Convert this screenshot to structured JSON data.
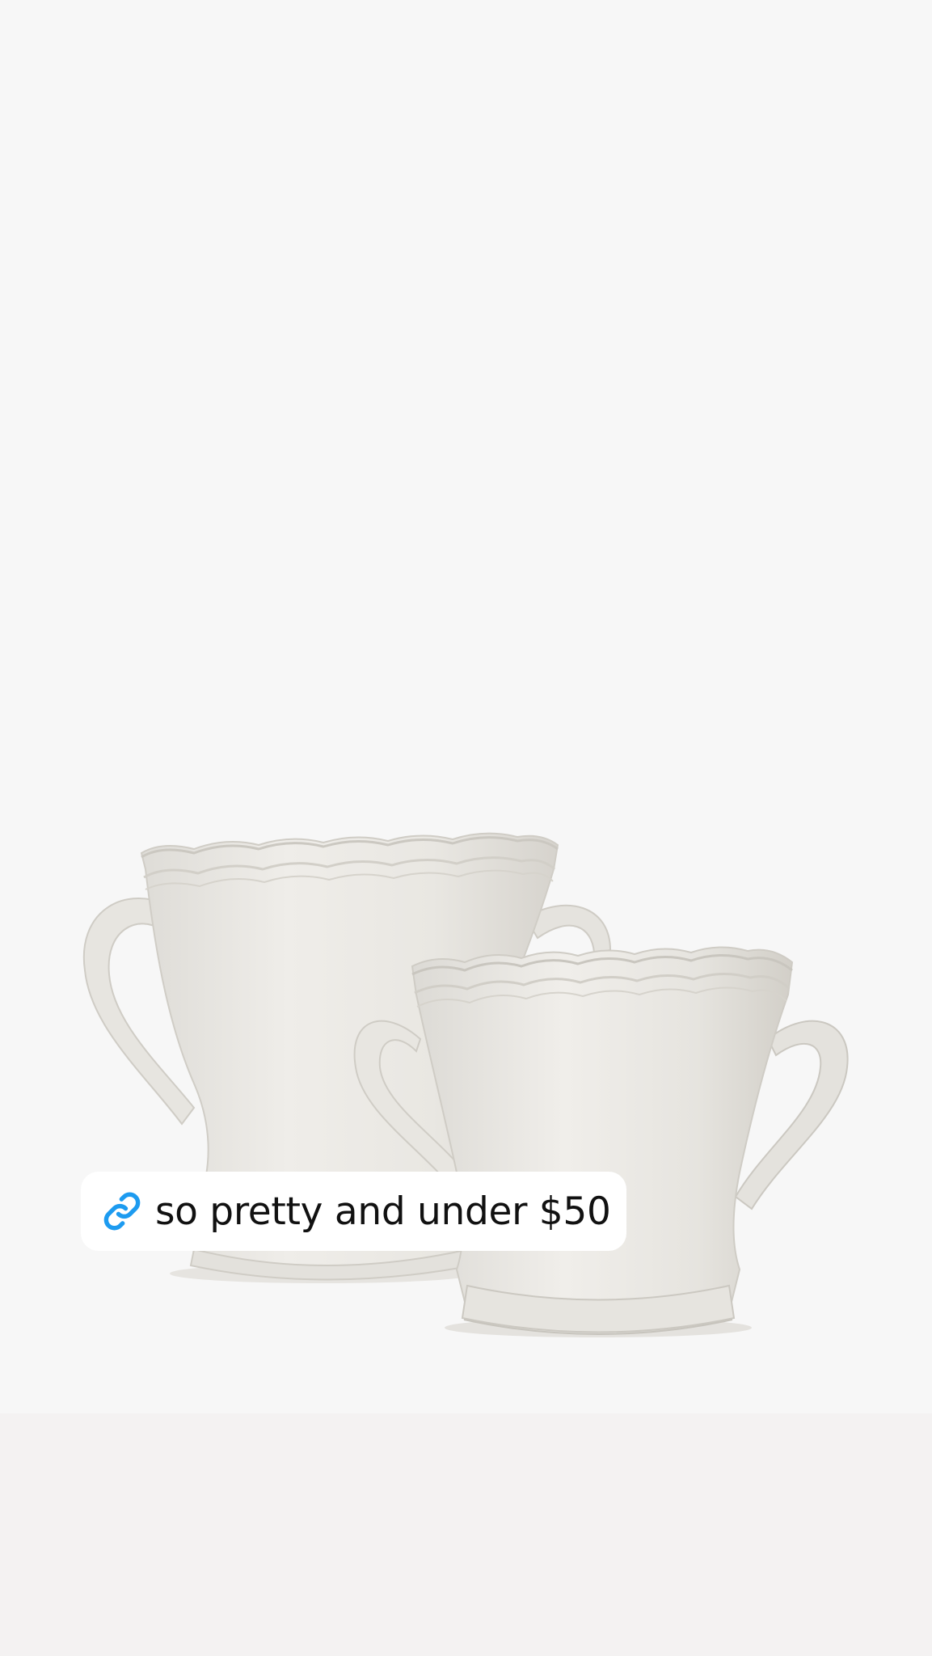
{
  "story": {
    "link_sticker": {
      "text": "so pretty and under $50",
      "icon": "link-icon",
      "icon_color": "#1d9bf0"
    },
    "background_color": "#f7f7f7",
    "photo": {
      "subject": "two-handled-ceramic-vases"
    }
  }
}
